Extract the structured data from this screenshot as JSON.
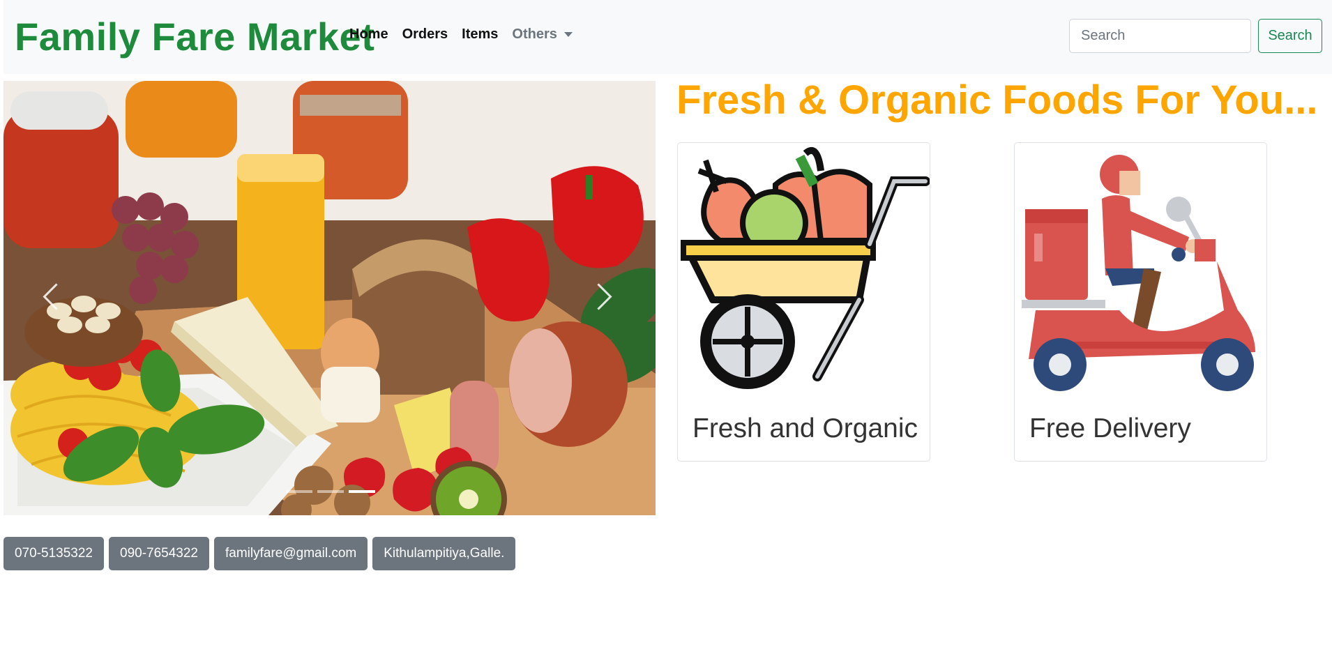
{
  "navbar": {
    "brand": "Family Fare Market",
    "links": [
      {
        "label": "Home"
      },
      {
        "label": "Orders"
      },
      {
        "label": "Items"
      }
    ],
    "dropdown_label": "Others",
    "search": {
      "placeholder": "Search",
      "value": "",
      "button_label": "Search"
    }
  },
  "hero": {
    "headline": "Fresh & Organic Foods For You...",
    "carousel": {
      "slide_count": 3,
      "active_index": 2,
      "image_icon": "food-spread-photo"
    }
  },
  "features": [
    {
      "title": "Fresh and Organic",
      "icon": "vegetable-cart-icon"
    },
    {
      "title": "Free Delivery",
      "icon": "delivery-scooter-icon"
    }
  ],
  "contacts": [
    {
      "label": "070-5135322"
    },
    {
      "label": "090-7654322"
    },
    {
      "label": "familyfare@gmail.com"
    },
    {
      "label": "Kithulampitiya,Galle."
    }
  ],
  "colors": {
    "brand": "#1e8a3c",
    "headline": "#ffa500",
    "search_button": "#198754",
    "contact_badge": "#6c757d",
    "navbar_bg": "#f8f9fa"
  }
}
